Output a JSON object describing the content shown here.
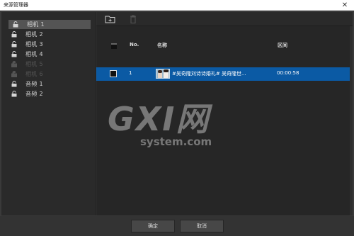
{
  "window": {
    "title": "来源管理器",
    "close_glyph": "✕"
  },
  "sidebar": {
    "items": [
      {
        "label": "相机 1",
        "selected": true,
        "disabled": false,
        "icon": "unlock-icon"
      },
      {
        "label": "相机 2",
        "selected": false,
        "disabled": false,
        "icon": "unlock-icon"
      },
      {
        "label": "相机 3",
        "selected": false,
        "disabled": false,
        "icon": "unlock-icon"
      },
      {
        "label": "相机 4",
        "selected": false,
        "disabled": false,
        "icon": "unlock-icon"
      },
      {
        "label": "相机 5",
        "selected": false,
        "disabled": true,
        "icon": "unlock-icon"
      },
      {
        "label": "相机 6",
        "selected": false,
        "disabled": true,
        "icon": "unlock-icon"
      },
      {
        "label": "音频 1",
        "selected": false,
        "disabled": false,
        "icon": "unlock-icon"
      },
      {
        "label": "音频 2",
        "selected": false,
        "disabled": false,
        "icon": "unlock-icon"
      }
    ]
  },
  "toolbar": {
    "add_icon": "add-folder-icon",
    "delete_icon": "trash-icon"
  },
  "table": {
    "headers": {
      "no": "No.",
      "name": "名称",
      "range": "区间"
    },
    "rows": [
      {
        "no": "1",
        "name": "#吴奇隆刘诗诗婚礼# 吴奇隆世...",
        "range": "00:00:58",
        "selected": true
      }
    ]
  },
  "watermark": {
    "main": "GXI网",
    "sub": "system.com"
  },
  "buttons": {
    "ok": "确定",
    "cancel": "取消"
  },
  "colors": {
    "selection": "#0b5aa4",
    "background": "#262626",
    "panel": "#2a2a2a"
  }
}
